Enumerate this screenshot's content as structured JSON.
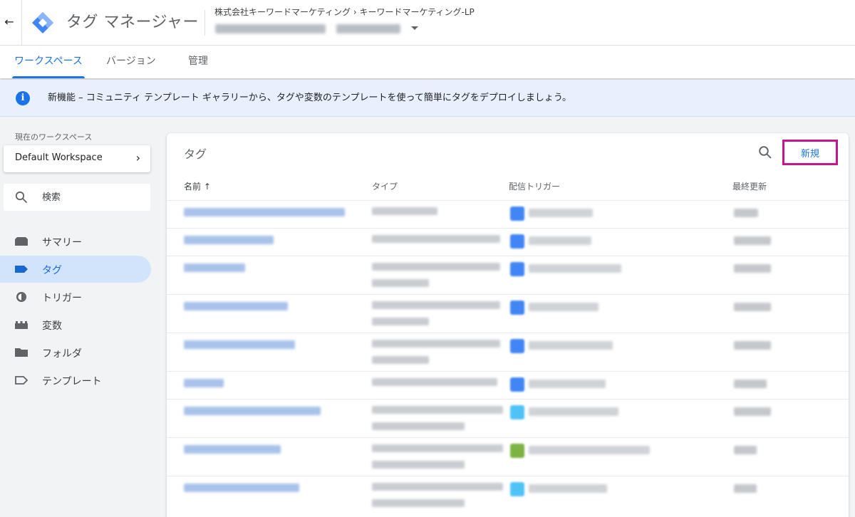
{
  "header": {
    "product_title": "タグ マネージャー",
    "breadcrumb": "株式会社キーワードマーケティング › キーワードマーケティング-LP"
  },
  "tabs": [
    {
      "label": "ワークスペース",
      "active": true
    },
    {
      "label": "バージョン",
      "active": false
    },
    {
      "label": "管理",
      "active": false
    }
  ],
  "banner": {
    "text": "新機能 – コミュニティ テンプレート ギャラリーから、タグや変数のテンプレートを使って簡単にタグをデプロイしましょう。"
  },
  "sidebar": {
    "workspace_label": "現在のワークスペース",
    "workspace_name": "Default Workspace",
    "search_placeholder": "検索",
    "items": [
      {
        "label": "サマリー",
        "icon": "summary-icon",
        "active": false
      },
      {
        "label": "タグ",
        "icon": "tag-icon",
        "active": true
      },
      {
        "label": "トリガー",
        "icon": "trigger-icon",
        "active": false
      },
      {
        "label": "変数",
        "icon": "variables-icon",
        "active": false
      },
      {
        "label": "フォルダ",
        "icon": "folder-icon",
        "active": false
      },
      {
        "label": "テンプレート",
        "icon": "template-icon",
        "active": false
      }
    ]
  },
  "main": {
    "title": "タグ",
    "new_button_label": "新規",
    "columns": {
      "name": "名前 ↑",
      "type": "タイプ",
      "trigger": "配信トリガー",
      "updated": "最終更新"
    }
  },
  "colors": {
    "accent": "#1a73e8",
    "highlight_border": "#c2188b",
    "active_nav_bg": "#d2e3fc",
    "banner_bg": "#e8f0fe",
    "trigger_blue": "#4285f4",
    "trigger_lightblue": "#4fc3f7",
    "trigger_green": "#7cb342"
  }
}
